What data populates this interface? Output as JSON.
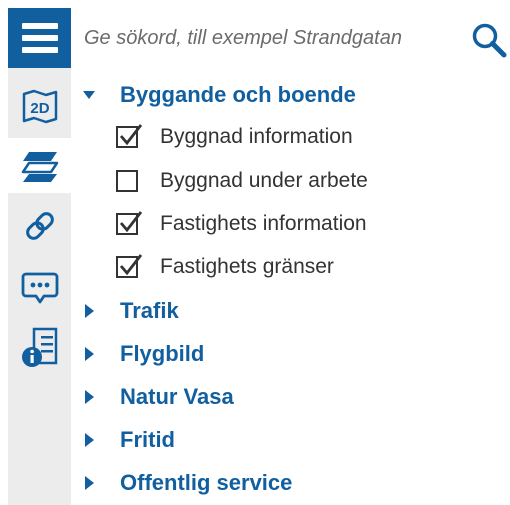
{
  "colors": {
    "accent": "#125fa0",
    "sidebar_bg": "#ececec",
    "text": "#333333",
    "placeholder": "#6b6b6b"
  },
  "sidebar": {
    "menu_icon": "hamburger-menu-icon",
    "items": [
      {
        "icon": "map-2d-icon",
        "label": "2D",
        "active": false
      },
      {
        "icon": "layers-icon",
        "active": true
      },
      {
        "icon": "link-icon",
        "active": false
      },
      {
        "icon": "speech-bubble-icon",
        "active": false
      },
      {
        "icon": "info-list-icon",
        "active": false
      }
    ]
  },
  "search": {
    "placeholder": "Ge sökord, till exempel Strandgatan",
    "value": "",
    "icon": "search-icon"
  },
  "tree": {
    "groups": [
      {
        "label": "Byggande och boende",
        "expanded": true,
        "layers": [
          {
            "label": "Byggnad information",
            "checked": true
          },
          {
            "label": "Byggnad under arbete",
            "checked": false
          },
          {
            "label": "Fastighets information",
            "checked": true
          },
          {
            "label": "Fastighets gränser",
            "checked": true
          }
        ]
      },
      {
        "label": "Trafik",
        "expanded": false
      },
      {
        "label": "Flygbild",
        "expanded": false
      },
      {
        "label": "Natur Vasa",
        "expanded": false
      },
      {
        "label": "Fritid",
        "expanded": false
      },
      {
        "label": "Offentlig service",
        "expanded": false
      }
    ]
  }
}
